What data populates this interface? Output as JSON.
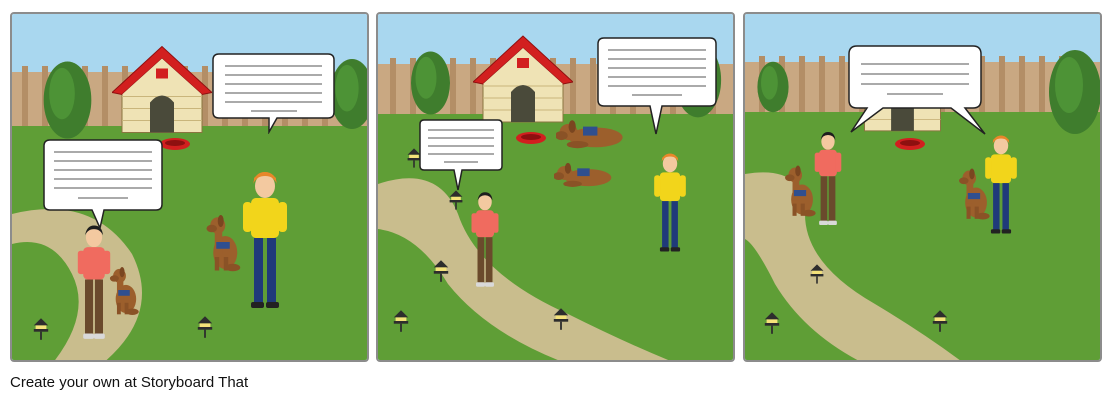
{
  "footer": {
    "credit": "Create your own at Storyboard That"
  },
  "colors": {
    "sky": "#a9d7ef",
    "grass": "#5f9e36",
    "fence": "#c9a882",
    "path": "#c9bd8d",
    "roof": "#d21f1f",
    "shirt_yellow": "#f2d51b",
    "shirt_red": "#f06b5f",
    "dog": "#9c5f2c"
  },
  "panels": [
    {
      "name": "panel-1",
      "bubbles": 2
    },
    {
      "name": "panel-2",
      "bubbles": 2
    },
    {
      "name": "panel-3",
      "bubbles": 1
    }
  ]
}
